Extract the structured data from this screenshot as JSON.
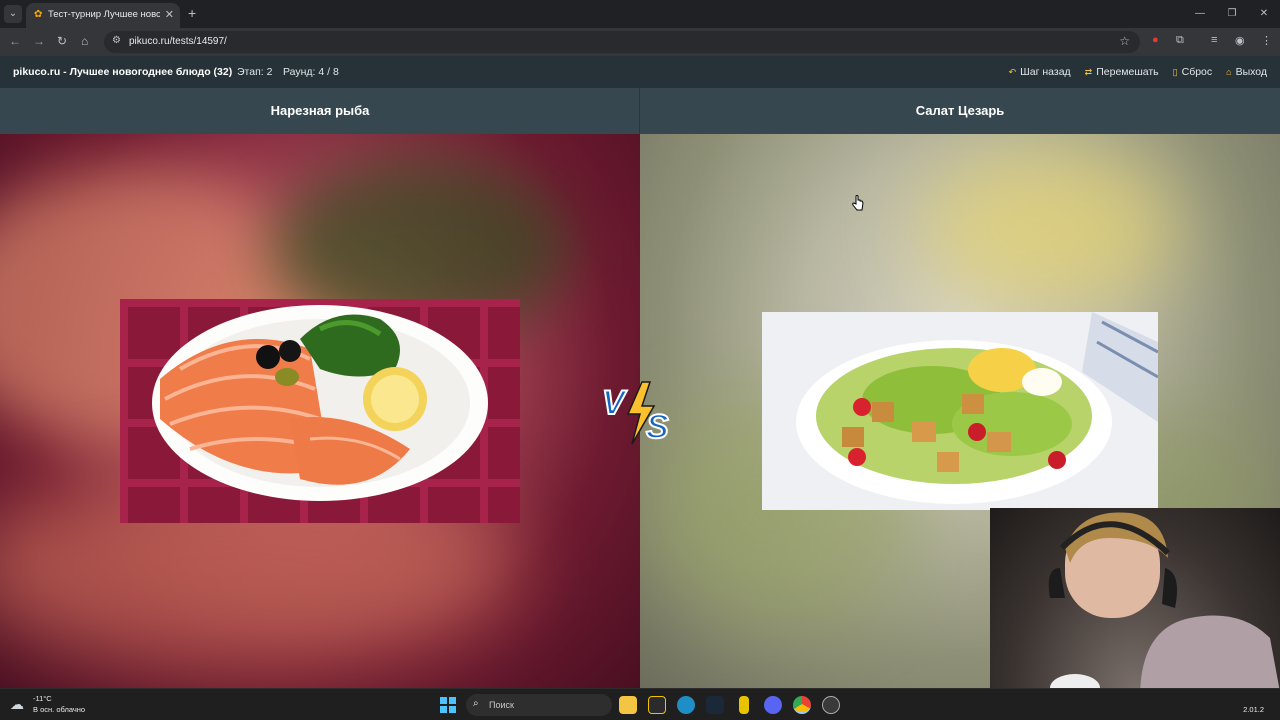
{
  "browser": {
    "tab_title": "Тест-турнир Лучшее новогоднее блюдо",
    "url": "pikuco.ru/tests/14597/",
    "new_tab_symbol": "+",
    "tab_close_symbol": "✕"
  },
  "site": {
    "brand": "pikuco.ru - Лучшее новогоднее блюдо (32)",
    "stage": "Этап: 2",
    "round": "Раунд: 4 / 8",
    "actions": [
      {
        "label": "Шаг назад",
        "icon": "undo-icon"
      },
      {
        "label": "Перемешать",
        "icon": "shuffle-icon"
      },
      {
        "label": "Сброс",
        "icon": "trash-icon"
      },
      {
        "label": "Выход",
        "icon": "home-icon"
      }
    ]
  },
  "options": {
    "left": {
      "title": "Нарезная рыба"
    },
    "right": {
      "title": "Салат Цезарь"
    }
  },
  "vs_label": "VS",
  "taskbar": {
    "weather_temp": "-11°C",
    "weather_desc": "В осн. облачно",
    "search_placeholder": "Поиск",
    "clock": "2.01.2"
  },
  "colors": {
    "header_bg": "#263238",
    "title_bar_bg": "#37474f",
    "accent": "#f6c343",
    "vs_blue": "#1565c0"
  }
}
